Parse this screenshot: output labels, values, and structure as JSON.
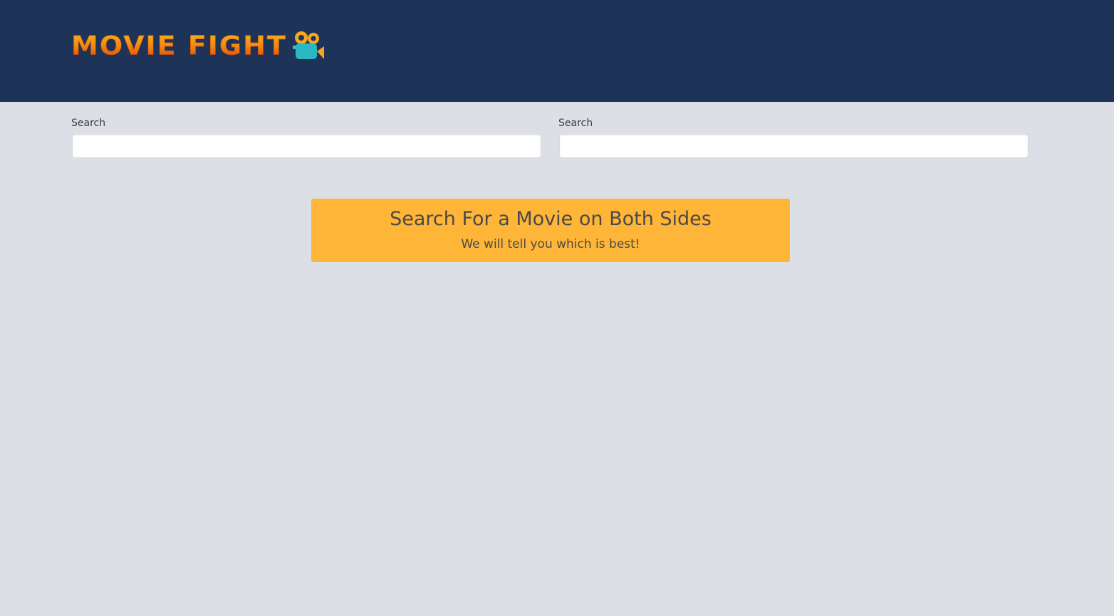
{
  "header": {
    "logo_text": "MOVIE FIGHT",
    "logo_icon": "movie-camera-icon",
    "background_color": "#1d3357"
  },
  "left_search": {
    "label": "Search",
    "value": "",
    "placeholder": ""
  },
  "right_search": {
    "label": "Search",
    "value": "",
    "placeholder": ""
  },
  "banner": {
    "title": "Search For a Movie on Both Sides",
    "subtitle": "We will tell you which is best!",
    "color": "#ffb538"
  },
  "page_background": "#dcdfe6"
}
